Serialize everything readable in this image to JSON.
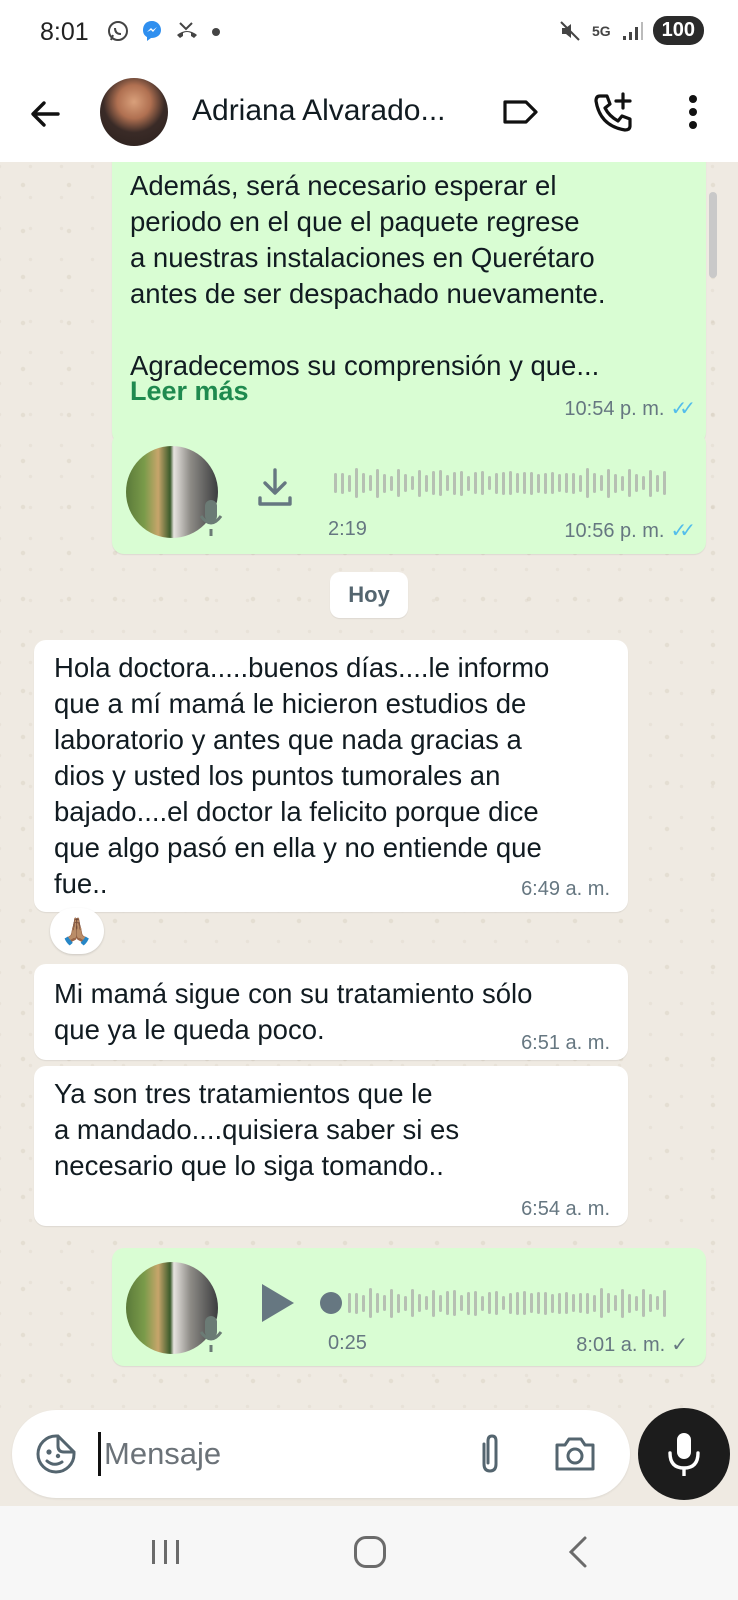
{
  "status_bar": {
    "time": "8:01",
    "left_icons": [
      "whatsapp-icon",
      "messenger-icon",
      "missed-call-icon",
      "dot-icon"
    ],
    "network": "5G",
    "battery": "100"
  },
  "header": {
    "contact_name": "Adriana Alvarado...",
    "icons": [
      "back-arrow-icon",
      "label-icon",
      "add-call-icon",
      "more-vert-icon"
    ]
  },
  "messages": [
    {
      "direction": "out",
      "type": "text",
      "text": "Además, será necesario esperar el\nperiodo en el que el paquete regrese\na nuestras instalaciones en Querétaro\nantes de ser despachado nuevamente.\n\nAgradecemos su comprensión y que...",
      "read_more": "Leer más",
      "time": "10:54 p. m.",
      "status": "read"
    },
    {
      "direction": "out",
      "type": "audio",
      "duration": "2:19",
      "time": "10:56 p. m.",
      "status": "read",
      "downloaded": false
    },
    {
      "type": "date_chip",
      "label": "Hoy"
    },
    {
      "direction": "in",
      "type": "text",
      "text": "Hola doctora.....buenos días....le informo\nque a mí mamá le hicieron estudios de\nlaboratorio y antes que nada gracias a\ndios y usted los puntos tumorales an\nbajado....el doctor la felicito porque dice\nque algo pasó en ella y no entiende que\nfue..",
      "time": "6:49 a. m.",
      "reaction": "🙏🏽"
    },
    {
      "direction": "in",
      "type": "text",
      "text": "Mi mamá sigue con su tratamiento sólo\nque ya le queda poco.",
      "time": "6:51 a. m."
    },
    {
      "direction": "in",
      "type": "text",
      "text": "Ya son tres tratamientos que le\na mandado....quisiera saber si es\nnecesario que lo siga tomando..",
      "time": "6:54 a. m."
    },
    {
      "direction": "out",
      "type": "audio",
      "duration": "0:25",
      "time": "8:01 a. m.",
      "status": "sent",
      "played_fraction": 0.0
    }
  ],
  "composer": {
    "placeholder": "Mensaje",
    "icons": [
      "sticker-icon",
      "attach-icon",
      "camera-icon",
      "mic-icon"
    ]
  },
  "colors": {
    "outgoing_bubble": "#d9fdd3",
    "incoming_bubble": "#ffffff",
    "chat_background": "#efeae2",
    "read_tick": "#53bdeb",
    "read_more_link": "#1f8a4f"
  }
}
